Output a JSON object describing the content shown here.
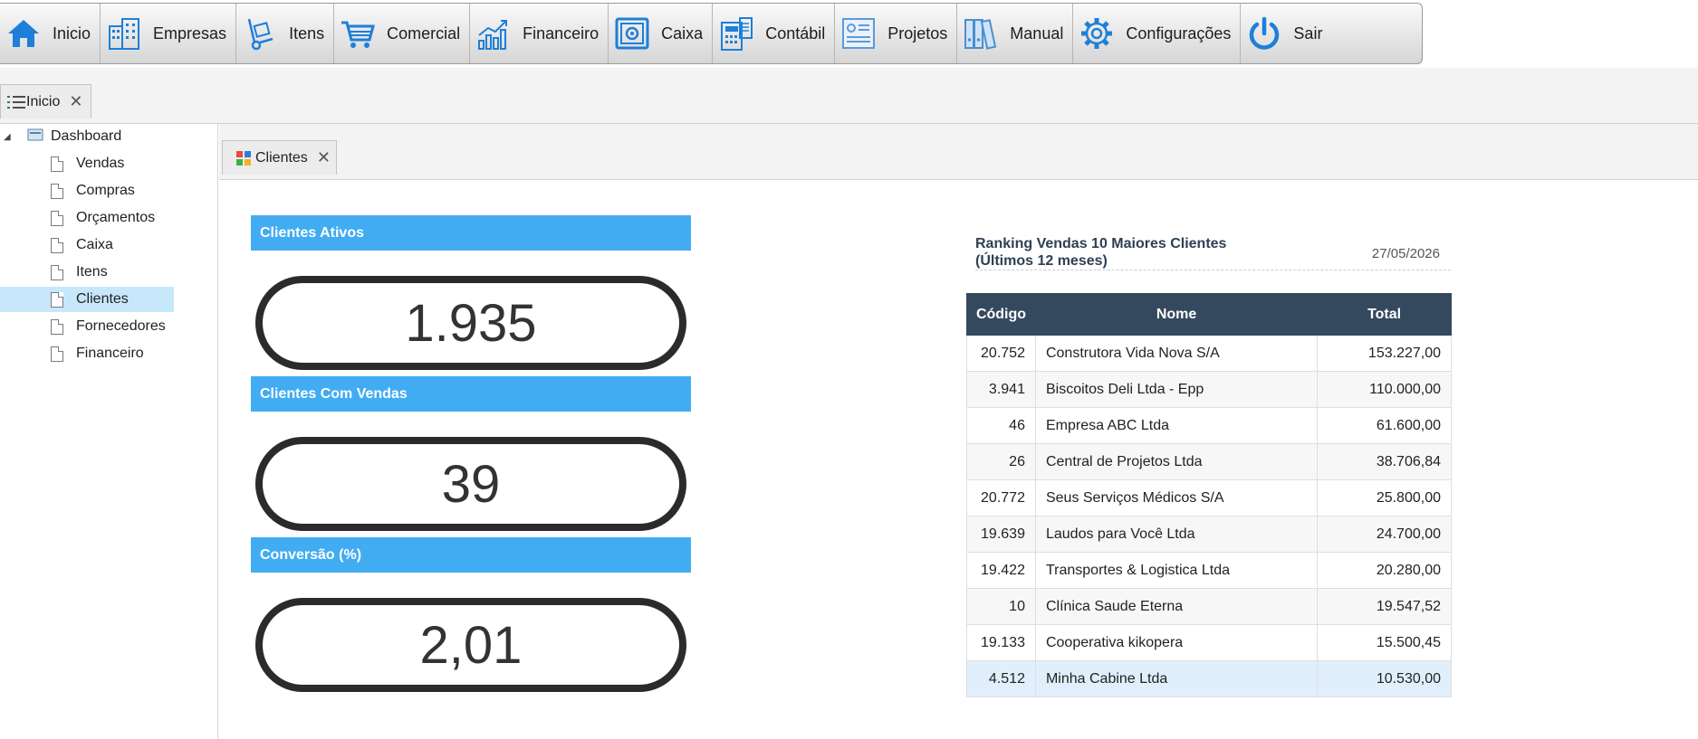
{
  "menu": [
    {
      "label": "Inicio",
      "icon": "home-icon"
    },
    {
      "label": "Empresas",
      "icon": "buildings-icon"
    },
    {
      "label": "Itens",
      "icon": "hand-truck-icon"
    },
    {
      "label": "Comercial",
      "icon": "shopping-cart-icon"
    },
    {
      "label": "Financeiro",
      "icon": "growth-chart-icon"
    },
    {
      "label": "Caixa",
      "icon": "safe-icon"
    },
    {
      "label": "Contábil",
      "icon": "calculator-icon"
    },
    {
      "label": "Projetos",
      "icon": "project-board-icon"
    },
    {
      "label": "Manual",
      "icon": "binders-icon"
    },
    {
      "label": "Configurações",
      "icon": "gear-icon"
    },
    {
      "label": "Sair",
      "icon": "power-icon"
    }
  ],
  "top_tab": {
    "label": "Inicio",
    "icon": "list-icon",
    "close": "✕"
  },
  "tree": {
    "root": {
      "label": "Dashboard",
      "icon": "dashboard-icon"
    },
    "items": [
      "Vendas",
      "Compras",
      "Orçamentos",
      "Caixa",
      "Itens",
      "Clientes",
      "Fornecedores",
      "Financeiro"
    ],
    "selected": "Clientes"
  },
  "content_tab": {
    "label": "Clientes",
    "icon": "apps-icon",
    "close": "✕"
  },
  "kpis": [
    {
      "title": "Clientes Ativos",
      "value": "1.935"
    },
    {
      "title": "Clientes Com Vendas",
      "value": "39"
    },
    {
      "title": "Conversão (%)",
      "value": "2,01"
    }
  ],
  "ranking": {
    "title_line1": "Ranking Vendas 10 Maiores Clientes",
    "title_line2": "(Últimos 12 meses)",
    "date": "27/05/2026",
    "columns": [
      "Código",
      "Nome",
      "Total"
    ],
    "rows": [
      [
        "20.752",
        "Construtora Vida Nova S/A",
        "153.227,00"
      ],
      [
        "3.941",
        "Biscoitos Deli Ltda - Epp",
        "110.000,00"
      ],
      [
        "46",
        "Empresa ABC Ltda",
        "61.600,00"
      ],
      [
        "26",
        "Central de Projetos Ltda",
        "38.706,84"
      ],
      [
        "20.772",
        "Seus Serviços Médicos S/A",
        "25.800,00"
      ],
      [
        "19.639",
        "Laudos para Você Ltda",
        "24.700,00"
      ],
      [
        "19.422",
        "Transportes & Logistica Ltda",
        "20.280,00"
      ],
      [
        "10",
        "Clínica Saude Eterna",
        "19.547,52"
      ],
      [
        "19.133",
        "Cooperativa kikopera",
        "15.500,45"
      ],
      [
        "4.512",
        "Minha Cabine Ltda",
        "10.530,00"
      ]
    ],
    "highlighted_row": 9
  },
  "colors": {
    "menu_icon": "#1e7fd8",
    "kpi_header": "#42acf2",
    "table_header": "#34495e",
    "selection": "#c7e8fb"
  }
}
